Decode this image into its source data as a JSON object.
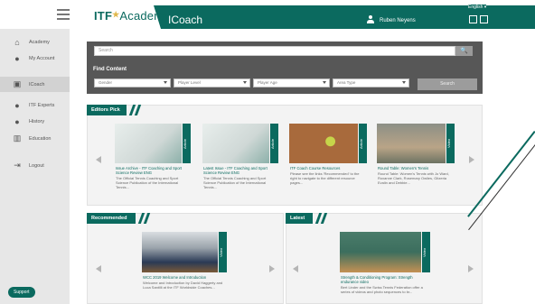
{
  "header": {
    "logo_main": "ITF",
    "logo_star": "★",
    "logo_sub": "Academy",
    "app_title": "ICoach",
    "user_name": "Ruben Neyens",
    "language": "English ▾"
  },
  "sidebar": {
    "items": [
      {
        "label": "Academy",
        "icon": "home-icon"
      },
      {
        "label": "My Account",
        "icon": "person-icon"
      },
      {
        "label": "ICoach",
        "icon": "video-icon"
      },
      {
        "label": "ITF Experts",
        "icon": "bullet-icon"
      },
      {
        "label": "History",
        "icon": "bullet-icon"
      },
      {
        "label": "Education",
        "icon": "book-icon"
      },
      {
        "label": "Logout",
        "icon": "logout-icon"
      }
    ],
    "support": "Support"
  },
  "search": {
    "placeholder": "Search",
    "button": "🔍"
  },
  "find_content": {
    "label": "Find Content",
    "filters": [
      "Gender",
      "Player Level",
      "Player Age",
      "Area Type"
    ],
    "search_button": "Search"
  },
  "editors_pick": {
    "title": "Editors Pick",
    "cards": [
      {
        "tag": "Article",
        "title": "Issue Archive - ITF Coaching and Sport Science Review ENG",
        "desc": "The Official Tennis Coaching and Sport Science Publication of the International Tennis..."
      },
      {
        "tag": "Article",
        "title": "Latest Issue - ITF Coaching and Sport Science Review ENG",
        "desc": "The Official Tennis Coaching and Sport Science Publication of the International Tennis..."
      },
      {
        "tag": "Article",
        "title": "ITF Coach Course Resources",
        "desc": "Please see the links 'Recommended' to the right to navigate to the different resource pages..."
      },
      {
        "tag": "Video",
        "title": "Round Table: Women's Tennis",
        "desc": "Round Table: Women's Tennis with Jo Ward, Roxanne Clark, Rosemary Owlies, Gitzeria Evalin and Debbie..."
      }
    ]
  },
  "recommended": {
    "title": "Recommended",
    "card": {
      "tag": "Video",
      "title": "WCC 2019 Welcome and Introduction",
      "desc": "Welcome and Introduction by David Haggerty and Luca Santilli at the ITF Worldwide Coaches..."
    }
  },
  "latest": {
    "title": "Latest",
    "card": {
      "tag": "Video",
      "title": "Strength & Conditioning Program: Strength endurance video",
      "desc": "Bert Linder and the Swiss Tennis Federation offer a series of videos and photo sequences to br..."
    }
  },
  "colors": {
    "brand": "#0b6a5f",
    "sidebar_bg": "#e7e7e7",
    "search_bg": "#575757"
  }
}
